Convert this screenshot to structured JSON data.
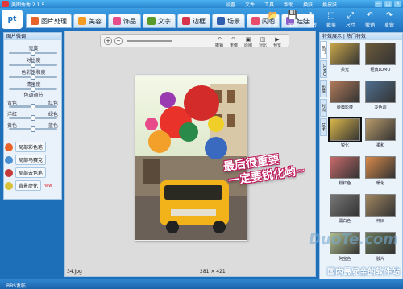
{
  "app": {
    "title": "美图秀秀 2.1.5",
    "logo": "pt",
    "minimize": "—",
    "maximize": "□",
    "close": "×"
  },
  "menus": [
    "设置",
    "文件",
    "工具",
    "帮助",
    "换肤",
    "换皮肤"
  ],
  "tabs": [
    {
      "label": "图片处理",
      "color": "#e8632a"
    },
    {
      "label": "美容",
      "color": "#f59a22"
    },
    {
      "label": "饰品",
      "color": "#e84b8a"
    },
    {
      "label": "文字",
      "color": "#5a9a2a"
    },
    {
      "label": "边框",
      "color": "#d9324b"
    },
    {
      "label": "场景",
      "color": "#2f5fae"
    },
    {
      "label": "闪图",
      "color": "#e94b6c"
    },
    {
      "label": "娃娃",
      "color": "#8c5fc9"
    }
  ],
  "right_tools": [
    {
      "label": "打开",
      "icon": "open-icon"
    },
    {
      "label": "保存",
      "icon": "save-icon"
    },
    {
      "label": "旋转",
      "icon": "rotate-icon"
    },
    {
      "label": "裁剪",
      "icon": "crop-icon"
    },
    {
      "label": "尺寸",
      "icon": "resize-icon"
    },
    {
      "label": "撤销",
      "icon": "undo-icon"
    },
    {
      "label": "重做",
      "icon": "redo-icon"
    }
  ],
  "left": {
    "header": "图片微调",
    "sliders": [
      {
        "label": "亮度",
        "value": 0.5
      },
      {
        "label": "对比度",
        "value": 0.5
      },
      {
        "label": "色彩饱和度",
        "value": 0.5
      },
      {
        "label": "清晰度",
        "value": 0.5
      }
    ],
    "color_header": "色调调节",
    "color_sliders": [
      {
        "left": "青色",
        "right": "红色",
        "value": 0.5
      },
      {
        "left": "洋红",
        "right": "绿色",
        "value": 0.5
      },
      {
        "left": "黄色",
        "right": "蓝色",
        "value": 0.5
      }
    ],
    "buttons": [
      {
        "label": "局部彩色笔",
        "color": "#e8632a"
      },
      {
        "label": "局部马赛克",
        "color": "#4a8fd0"
      },
      {
        "label": "局部去色笔",
        "color": "#c43a3a"
      },
      {
        "label": "背景虚化",
        "color": "#d9c23a",
        "badge": "new"
      }
    ]
  },
  "canvas": {
    "zoom_in": "+",
    "zoom_out": "−",
    "tools": [
      "撤销",
      "重做",
      "原图",
      "对比",
      "预览"
    ],
    "filename": "34.jpg",
    "dimensions": "281 × 421",
    "callout": [
      "最后很重要",
      "一定要锐化哟~"
    ]
  },
  "right": {
    "header": "特效展示 | 热门特效",
    "vtabs": [
      "热门",
      "LOMO",
      "影楼",
      "时尚",
      "艺术"
    ],
    "tiles": [
      {
        "label": "柔光",
        "color": "#c9a64a"
      },
      {
        "label": "经典LOMO",
        "color": "#6a5a3a"
      },
      {
        "label": "经典影楼",
        "color": "#b07a5a"
      },
      {
        "label": "冷色调",
        "color": "#4f6f8f"
      },
      {
        "label": "锐化",
        "color": "#d9b64a",
        "selected": true
      },
      {
        "label": "柔和",
        "color": "#b89a6a"
      },
      {
        "label": "粉红色",
        "color": "#c96a6a"
      },
      {
        "label": "暖化",
        "color": "#d98a4a"
      },
      {
        "label": "黑白色",
        "color": "#777777"
      },
      {
        "label": "怀旧",
        "color": "#a08660"
      },
      {
        "label": "阿宝色",
        "color": "#b0c090"
      },
      {
        "label": "胶片",
        "color": "#6a7a5a"
      }
    ]
  },
  "status": "BBS发帖",
  "watermark": "DuoTe.com",
  "watermark2": "国内最安全的软件站"
}
